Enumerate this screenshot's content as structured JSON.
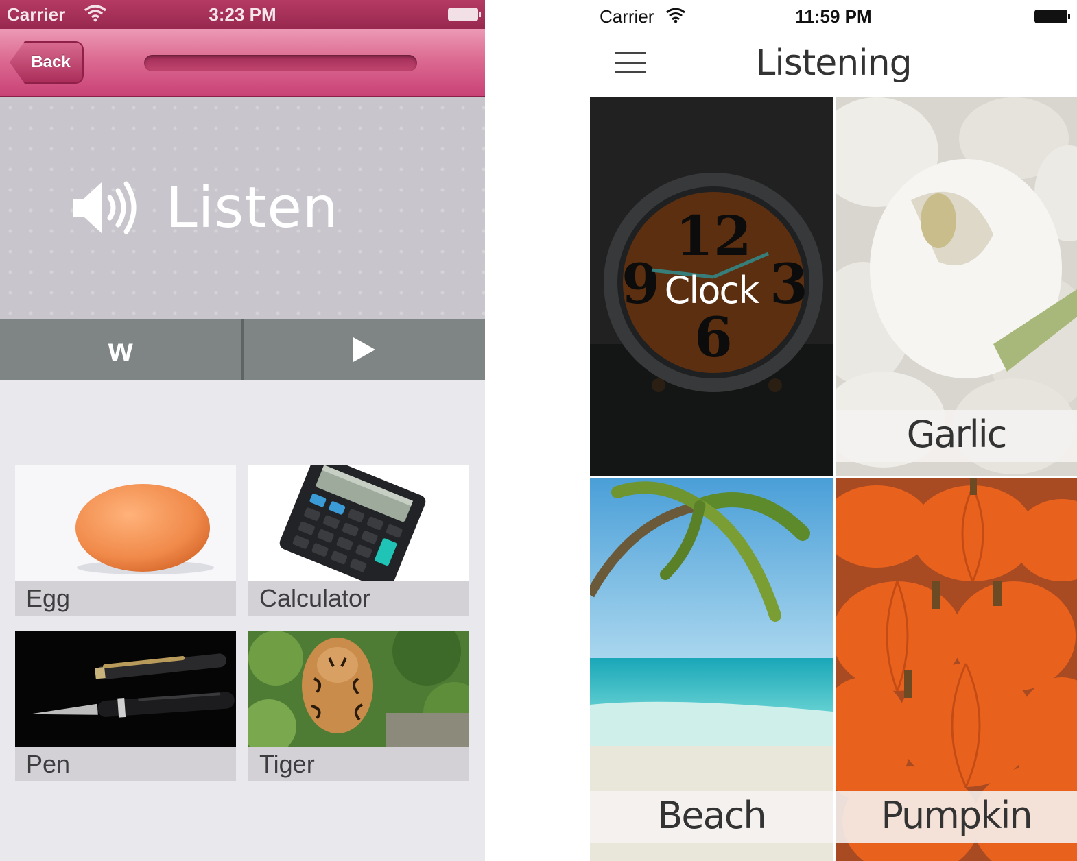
{
  "left_app": {
    "status_bar": {
      "carrier": "Carrier",
      "time": "3:23 PM"
    },
    "nav": {
      "back_label": "Back",
      "progress": 0.0
    },
    "header": {
      "title": "Listen",
      "icon": "speaker-icon"
    },
    "segmented": {
      "left_label": "w",
      "right_icon": "play-icon"
    },
    "tiles": [
      {
        "label": "Egg"
      },
      {
        "label": "Calculator"
      },
      {
        "label": "Pen"
      },
      {
        "label": "Tiger"
      }
    ],
    "colors": {
      "accent": "#d0517f",
      "segment": "#7e8584"
    }
  },
  "right_app": {
    "status_bar": {
      "carrier": "Carrier",
      "time": "11:59 PM"
    },
    "nav": {
      "title": "Listening",
      "menu_icon": "hamburger-menu-icon"
    },
    "tiles": [
      {
        "label": "Clock"
      },
      {
        "label": "Garlic"
      },
      {
        "label": "Beach"
      },
      {
        "label": "Pumpkin"
      }
    ]
  }
}
